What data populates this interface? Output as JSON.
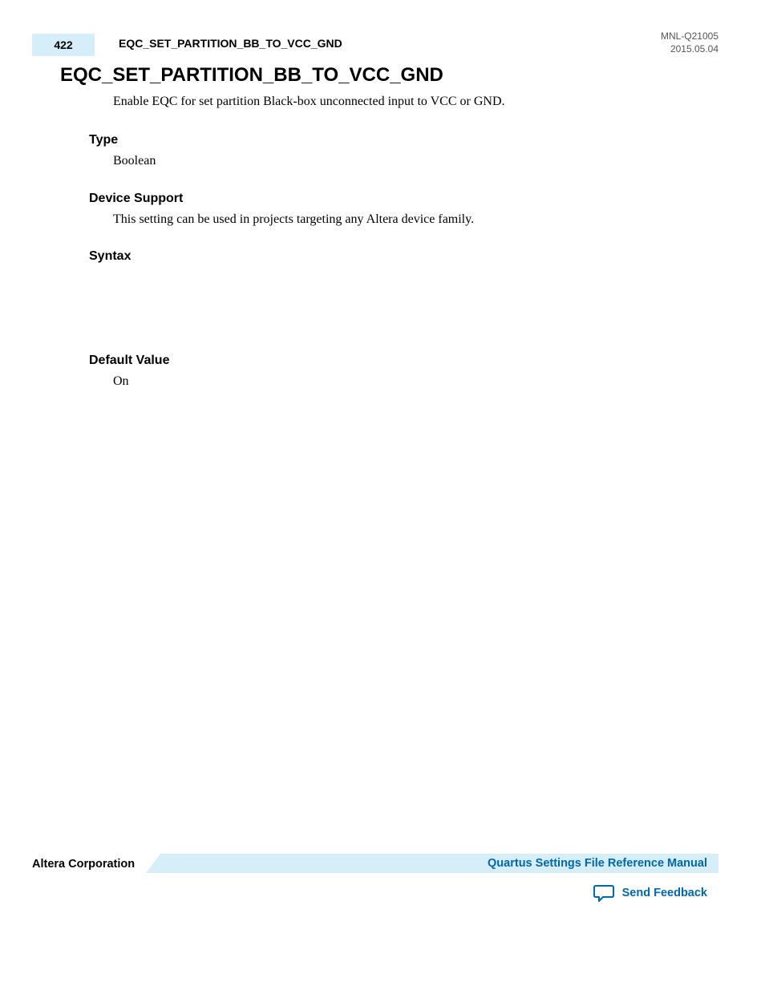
{
  "header": {
    "page_number": "422",
    "title": "EQC_SET_PARTITION_BB_TO_VCC_GND",
    "doc_id": "MNL-Q21005",
    "date": "2015.05.04"
  },
  "main": {
    "heading": "EQC_SET_PARTITION_BB_TO_VCC_GND",
    "description": "Enable EQC for set partition Black-box unconnected input to VCC or GND.",
    "sections": {
      "type": {
        "label": "Type",
        "value": "Boolean"
      },
      "device_support": {
        "label": "Device Support",
        "value": "This setting can be used in projects targeting any Altera device family."
      },
      "syntax": {
        "label": "Syntax",
        "value": ""
      },
      "default_value": {
        "label": "Default Value",
        "value": "On"
      }
    }
  },
  "footer": {
    "company": "Altera Corporation",
    "manual_link": "Quartus Settings File Reference Manual",
    "feedback": "Send Feedback"
  }
}
